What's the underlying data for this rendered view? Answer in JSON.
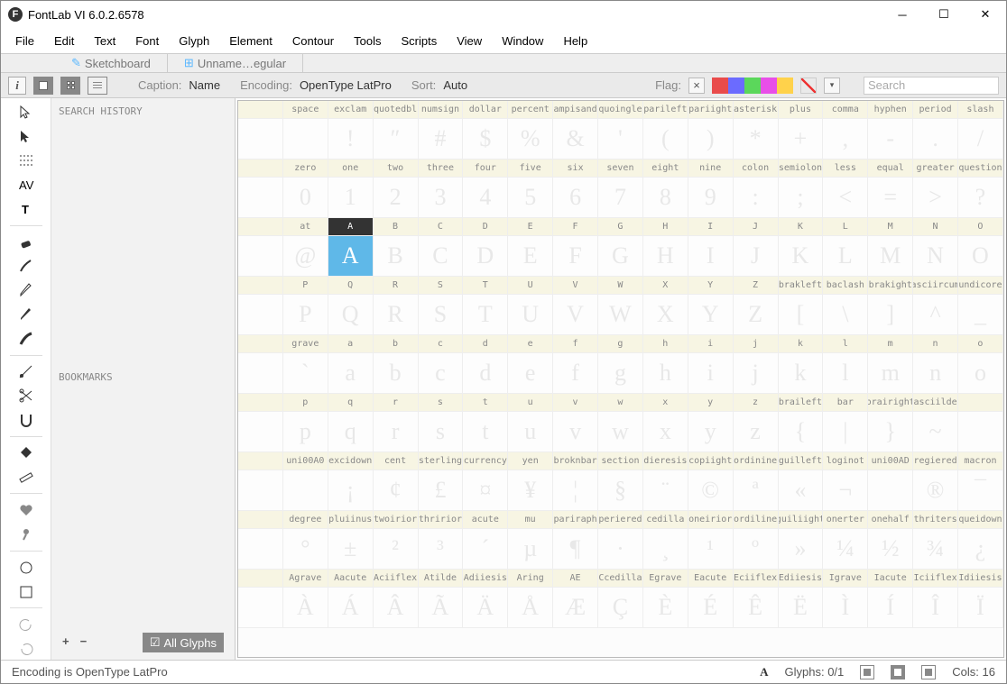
{
  "title": "FontLab VI 6.0.2.6578",
  "menu": [
    "File",
    "Edit",
    "Text",
    "Font",
    "Glyph",
    "Element",
    "Contour",
    "Tools",
    "Scripts",
    "View",
    "Window",
    "Help"
  ],
  "tabs": [
    {
      "icon": "✎",
      "label": "Sketchboard"
    },
    {
      "icon": "⊞",
      "label": "Unname…egular"
    }
  ],
  "options": {
    "caption_label": "Caption:",
    "caption_value": "Name",
    "encoding_label": "Encoding:",
    "encoding_value": "OpenType LatPro",
    "sort_label": "Sort:",
    "sort_value": "Auto",
    "flag_label": "Flag:",
    "search_placeholder": "Search"
  },
  "swatches": [
    "#e94b4b",
    "#6b6bff",
    "#5bd75b",
    "#e84fe8",
    "#ffd24b"
  ],
  "side": {
    "search_history": "SEARCH HISTORY",
    "bookmarks": "BOOKMARKS",
    "all_glyphs": "All Glyphs"
  },
  "selected": "A",
  "rows": [
    {
      "names": [
        "",
        "space",
        "exclam",
        "quotedbl",
        "numsign",
        "dollar",
        "percent",
        "ampisand",
        "quoingle",
        "parileft",
        "pariight",
        "asterisk",
        "plus",
        "comma",
        "hyphen",
        "period",
        "slash"
      ],
      "glyphs": [
        "",
        "",
        "!",
        "″",
        "#",
        "$",
        "%",
        "&",
        "'",
        "(",
        ")",
        "*",
        "+",
        ",",
        "-",
        ".",
        "/"
      ]
    },
    {
      "names": [
        "",
        "zero",
        "one",
        "two",
        "three",
        "four",
        "five",
        "six",
        "seven",
        "eight",
        "nine",
        "colon",
        "semiolon",
        "less",
        "equal",
        "greater",
        "question"
      ],
      "glyphs": [
        "",
        "0",
        "1",
        "2",
        "3",
        "4",
        "5",
        "6",
        "7",
        "8",
        "9",
        ":",
        ";",
        "<",
        "=",
        ">",
        "?"
      ]
    },
    {
      "names": [
        "",
        "at",
        "A",
        "B",
        "C",
        "D",
        "E",
        "F",
        "G",
        "H",
        "I",
        "J",
        "K",
        "L",
        "M",
        "N",
        "O"
      ],
      "glyphs": [
        "",
        "@",
        "A",
        "B",
        "C",
        "D",
        "E",
        "F",
        "G",
        "H",
        "I",
        "J",
        "K",
        "L",
        "M",
        "N",
        "O"
      ]
    },
    {
      "names": [
        "",
        "P",
        "Q",
        "R",
        "S",
        "T",
        "U",
        "V",
        "W",
        "X",
        "Y",
        "Z",
        "brakleft",
        "baclash",
        "brakight",
        "asciircum",
        "undicore"
      ],
      "glyphs": [
        "",
        "P",
        "Q",
        "R",
        "S",
        "T",
        "U",
        "V",
        "W",
        "X",
        "Y",
        "Z",
        "[",
        "\\",
        "]",
        "^",
        "_"
      ]
    },
    {
      "names": [
        "",
        "grave",
        "a",
        "b",
        "c",
        "d",
        "e",
        "f",
        "g",
        "h",
        "i",
        "j",
        "k",
        "l",
        "m",
        "n",
        "o"
      ],
      "glyphs": [
        "",
        "`",
        "a",
        "b",
        "c",
        "d",
        "e",
        "f",
        "g",
        "h",
        "i",
        "j",
        "k",
        "l",
        "m",
        "n",
        "o"
      ]
    },
    {
      "names": [
        "",
        "p",
        "q",
        "r",
        "s",
        "t",
        "u",
        "v",
        "w",
        "x",
        "y",
        "z",
        "braileft",
        "bar",
        "brairight",
        "asciilde",
        ""
      ],
      "glyphs": [
        "",
        "p",
        "q",
        "r",
        "s",
        "t",
        "u",
        "v",
        "w",
        "x",
        "y",
        "z",
        "{",
        "|",
        "}",
        "~",
        ""
      ]
    },
    {
      "names": [
        "",
        "uni00A0",
        "excidown",
        "cent",
        "sterling",
        "currency",
        "yen",
        "broknbar",
        "section",
        "dieresis",
        "copiight",
        "ordinine",
        "guilleft",
        "loginot",
        "uni00AD",
        "regiered",
        "macron"
      ],
      "glyphs": [
        "",
        "",
        "¡",
        "¢",
        "£",
        "¤",
        "¥",
        "¦",
        "§",
        "¨",
        "©",
        "ª",
        "«",
        "¬",
        "",
        "®",
        "¯"
      ]
    },
    {
      "names": [
        "",
        "degree",
        "pluiinus",
        "twoirior",
        "thririor",
        "acute",
        "mu",
        "pariraph",
        "periered",
        "cedilla",
        "oneirior",
        "ordiline",
        "guiliight",
        "onerter",
        "onehalf",
        "thriters",
        "queidown"
      ],
      "glyphs": [
        "",
        "°",
        "±",
        "²",
        "³",
        "´",
        "µ",
        "¶",
        "·",
        "¸",
        "¹",
        "º",
        "»",
        "¼",
        "½",
        "¾",
        "¿"
      ]
    },
    {
      "names": [
        "",
        "Agrave",
        "Aacute",
        "Aciiflex",
        "Atilde",
        "Adiiesis",
        "Aring",
        "AE",
        "Ccedilla",
        "Egrave",
        "Eacute",
        "Eciiflex",
        "Ediiesis",
        "Igrave",
        "Iacute",
        "Iciiflex",
        "Idiiesis"
      ],
      "glyphs": [
        "",
        "À",
        "Á",
        "Â",
        "Ã",
        "Ä",
        "Å",
        "Æ",
        "Ç",
        "È",
        "É",
        "Ê",
        "Ë",
        "Ì",
        "Í",
        "Î",
        "Ï"
      ]
    }
  ],
  "status": {
    "encoding": "Encoding is OpenType LatPro",
    "glyphs_label": "Glyphs:",
    "glyphs_value": "0/1",
    "cols_label": "Cols:",
    "cols_value": "16"
  }
}
